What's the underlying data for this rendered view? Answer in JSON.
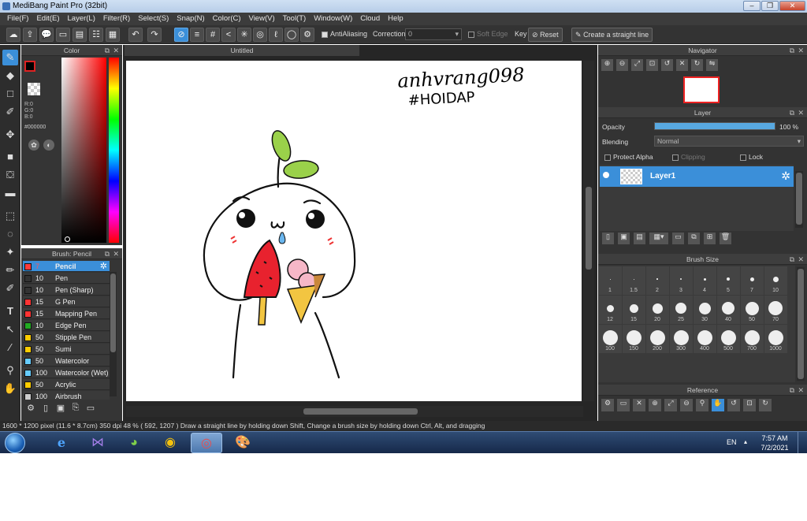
{
  "window": {
    "title": "MediBang Paint Pro (32bit)"
  },
  "menu": [
    "File(F)",
    "Edit(E)",
    "Layer(L)",
    "Filter(R)",
    "Select(S)",
    "Snap(N)",
    "Color(C)",
    "View(V)",
    "Tool(T)",
    "Window(W)",
    "Cloud",
    "Help"
  ],
  "toolbar": {
    "antialias_label": "AntiAliasing",
    "correction_label": "Correction",
    "correction_value": "0",
    "soft_edge_label": "Soft Edge",
    "key_label": "Key",
    "reset_label": "Reset",
    "straight_line_label": "Create a straight line"
  },
  "color_panel": {
    "title": "Color",
    "r": "R:0",
    "g": "G:0",
    "b": "B:0",
    "hex": "#000000"
  },
  "brush_panel": {
    "title": "Brush: Pencil",
    "items": [
      {
        "size": "7",
        "name": "Pencil",
        "color": "#ff3b3b"
      },
      {
        "size": "10",
        "name": "Pen",
        "color": "#333333"
      },
      {
        "size": "10",
        "name": "Pen (Sharp)",
        "color": "#333333"
      },
      {
        "size": "15",
        "name": "G Pen",
        "color": "#ff3333"
      },
      {
        "size": "15",
        "name": "Mapping Pen",
        "color": "#ff3333"
      },
      {
        "size": "10",
        "name": "Edge Pen",
        "color": "#22aa22"
      },
      {
        "size": "50",
        "name": "Stipple Pen",
        "color": "#ffcc00"
      },
      {
        "size": "50",
        "name": "Sumi",
        "color": "#ffcc00"
      },
      {
        "size": "50",
        "name": "Watercolor",
        "color": "#66ccff"
      },
      {
        "size": "100",
        "name": "Watercolor (Wet)",
        "color": "#66ccff"
      },
      {
        "size": "50",
        "name": "Acrylic",
        "color": "#ffcc00"
      },
      {
        "size": "100",
        "name": "Airbrush",
        "color": "#cccccc"
      }
    ]
  },
  "document": {
    "tab": "Untitled",
    "handwriting_line1": "anhvrang098",
    "handwriting_line2": "#HOIDAP"
  },
  "navigator": {
    "title": "Navigator"
  },
  "layer_panel": {
    "title": "Layer",
    "opacity_label": "Opacity",
    "opacity_value": "100 %",
    "opacity": 100,
    "blending_label": "Blending",
    "blending_value": "Normal",
    "protect_alpha": "Protect Alpha",
    "clipping": "Clipping",
    "lock": "Lock",
    "layer_name": "Layer1"
  },
  "brush_size_panel": {
    "title": "Brush Size",
    "sizes": [
      "1",
      "1.5",
      "2",
      "3",
      "4",
      "5",
      "7",
      "10",
      "12",
      "15",
      "20",
      "25",
      "30",
      "40",
      "50",
      "70",
      "100",
      "150",
      "200",
      "300",
      "400",
      "500",
      "700",
      "1000"
    ]
  },
  "reference_panel": {
    "title": "Reference"
  },
  "status": {
    "pixels": "1600 * 1200 pixel",
    "cm": "(11.6 * 8.7cm)",
    "dpi": "350 dpi",
    "zoom": "48 %",
    "coords": "( 592, 1207 )",
    "hint": "Draw a straight line by holding down Shift, Change a brush size by holding down Ctrl, Alt, and dragging"
  },
  "taskbar": {
    "lang": "EN",
    "time": "7:57 AM",
    "date": "7/2/2021"
  }
}
